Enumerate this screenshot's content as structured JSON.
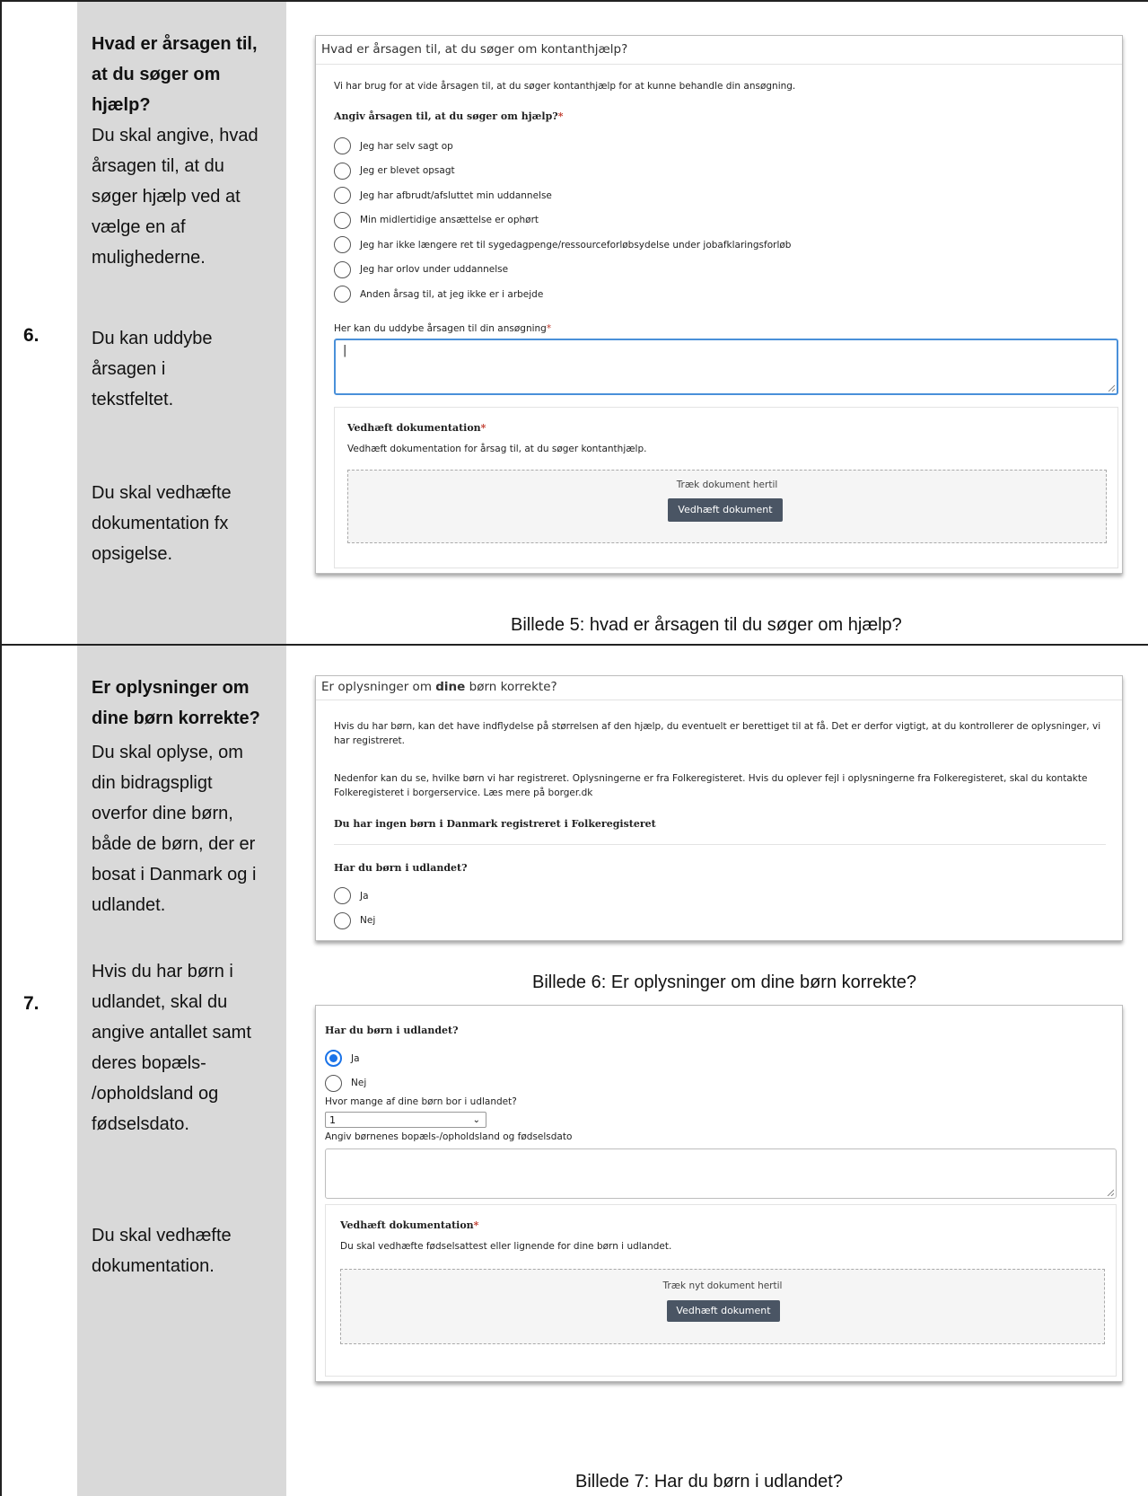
{
  "rows": [
    {
      "number": "6.",
      "desc": {
        "title_lines": [
          "Hvad er årsagen til,",
          "at du søger om",
          "hjælp?"
        ],
        "body_lines": [
          "Du skal angive, hvad",
          "årsagen til, at du",
          "søger hjælp ved at",
          "vælge en af",
          "mulighederne."
        ],
        "elaborate_lines": [
          "Du kan uddybe",
          "årsagen i",
          "tekstfeltet."
        ],
        "attach_lines": [
          "Du skal vedhæfte",
          "dokumentation fx",
          "opsigelse."
        ]
      },
      "panel": {
        "header": "Hvad er årsagen til, at du søger om kontanthjælp?",
        "intro": "Vi har brug for at vide årsagen til, at du søger kontanthjælp for at kunne behandle din ansøgning.",
        "question": "Angiv årsagen til, at du søger om hjælp?",
        "required_mark": "*",
        "options": [
          "Jeg har selv sagt op",
          "Jeg er blevet opsagt",
          "Jeg har afbrudt/afsluttet min uddannelse",
          "Min midlertidige ansættelse er ophørt",
          "Jeg har ikke længere ret til sygedagpenge/ressourceforløbsydelse under jobafklaringsforløb",
          "Jeg har orlov under uddannelse",
          "Anden årsag til, at jeg ikke er i arbejde"
        ],
        "textarea_label": "Her kan du uddybe årsagen til din ansøgning",
        "textarea_value": "|",
        "attach_title": "Vedhæft dokumentation",
        "attach_text": "Vedhæft dokumentation for årsag til, at du søger kontanthjælp.",
        "drop_text": "Træk dokument hertil",
        "attach_button": "Vedhæft dokument"
      },
      "caption": "Billede 5: hvad er årsagen til du søger om hjælp?"
    },
    {
      "number": "7.",
      "desc": {
        "title_lines": [
          "Er oplysninger om",
          "dine børn korrekte?"
        ],
        "body_lines": [
          "Du skal oplyse, om",
          "din bidragspligt",
          "overfor dine børn,",
          "både de børn, der er",
          "bosat i Danmark og i",
          "udlandet."
        ],
        "abroad_lines": [
          "Hvis du har børn i",
          "udlandet, skal du",
          "angive antallet samt",
          "deres bopæls-",
          "/opholdsland og",
          "fødselsdato."
        ],
        "attach_lines": [
          "Du skal vedhæfte",
          "dokumentation."
        ]
      },
      "panel_a": {
        "header_pre": "Er oplysninger om ",
        "header_bold": "dine",
        "header_post": " børn korrekte?",
        "para1": "Hvis du har børn, kan det have indflydelse på størrelsen af den hjælp, du eventuelt er berettiget til at få. Det er derfor vigtigt, at du kontrollerer de oplysninger, vi har registreret.",
        "para2": "Nedenfor kan du se, hvilke børn vi har registreret. Oplysningerne er fra Folkeregisteret. Hvis du oplever fejl i oplysningerne fra Folkeregisteret, skal du kontakte Folkeregisteret i borgerservice. Læs mere på borger.dk",
        "no_children": "Du har ingen børn i Danmark registreret i Folkeregisteret",
        "question": "Har du børn i udlandet?",
        "options": [
          "Ja",
          "Nej"
        ]
      },
      "caption_a": "Billede 6: Er oplysninger om dine børn korrekte?",
      "panel_b": {
        "question": "Har du børn i udlandet?",
        "options": [
          "Ja",
          "Nej"
        ],
        "selected": "Ja",
        "count_label": "Hvor mange af dine børn bor i udlandet?",
        "count_value": "1",
        "country_label": "Angiv børnenes bopæls-/opholdsland og fødselsdato",
        "attach_title": "Vedhæft dokumentation",
        "attach_text": "Du skal vedhæfte fødselsattest eller lignende for dine børn i udlandet.",
        "drop_text": "Træk nyt dokument hertil",
        "attach_button": "Vedhæft dokument"
      },
      "caption_b": "Billede 7: Har du børn i udlandet?"
    }
  ]
}
